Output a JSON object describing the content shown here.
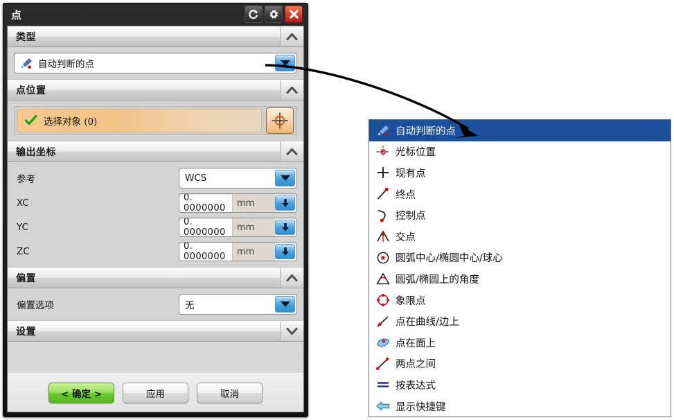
{
  "dialog": {
    "title": "点",
    "title_buttons": [
      {
        "name": "reset-button",
        "icon": "reset-icon"
      },
      {
        "name": "settings-button",
        "icon": "gear-icon"
      },
      {
        "name": "close-button",
        "icon": "close-icon"
      }
    ],
    "sections": [
      {
        "label": "类型",
        "state": "expanded",
        "chevron": "chevron-up-icon"
      },
      {
        "label": "点位置",
        "state": "expanded",
        "chevron": "chevron-up-icon"
      },
      {
        "label": "输出坐标",
        "state": "expanded",
        "chevron": "chevron-up-icon"
      },
      {
        "label": "偏置",
        "state": "expanded",
        "chevron": "chevron-up-icon"
      },
      {
        "label": "设置",
        "state": "collapsed",
        "chevron": "chevron-down-icon"
      }
    ],
    "type_combo": {
      "value": "自动判断的点",
      "icon": "inferred-point-icon"
    },
    "point_location": {
      "select_object_label": "选择对象 (0)",
      "check_icon": "green-check-icon",
      "pick_button_icon": "crosshair-point-icon"
    },
    "output_coordinates": {
      "reference_label": "参考",
      "reference_value": "WCS",
      "fields": [
        {
          "label": "XC",
          "value": "0. 0000000",
          "unit": "mm"
        },
        {
          "label": "YC",
          "value": "0. 0000000",
          "unit": "mm"
        },
        {
          "label": "ZC",
          "value": "0. 0000000",
          "unit": "mm"
        }
      ]
    },
    "offset": {
      "option_label": "偏置选项",
      "option_value": "无"
    },
    "buttons": {
      "ok": "< 确定 >",
      "apply": "应用",
      "cancel": "取消"
    }
  },
  "dropdown_list": {
    "items": [
      {
        "label": "自动判断的点",
        "icon": "inferred-point-icon",
        "selected": true
      },
      {
        "label": "光标位置",
        "icon": "cursor-location-icon",
        "selected": false
      },
      {
        "label": "现有点",
        "icon": "existing-point-icon",
        "selected": false
      },
      {
        "label": "终点",
        "icon": "end-point-icon",
        "selected": false
      },
      {
        "label": "控制点",
        "icon": "control-point-icon",
        "selected": false
      },
      {
        "label": "交点",
        "icon": "intersection-point-icon",
        "selected": false
      },
      {
        "label": "圆弧中心/椭圆中心/球心",
        "icon": "arc-center-icon",
        "selected": false
      },
      {
        "label": "圆弧/椭圆上的角度",
        "icon": "arc-angle-icon",
        "selected": false
      },
      {
        "label": "象限点",
        "icon": "quadrant-point-icon",
        "selected": false
      },
      {
        "label": "点在曲线/边上",
        "icon": "point-on-curve-icon",
        "selected": false
      },
      {
        "label": "点在面上",
        "icon": "point-on-face-icon",
        "selected": false
      },
      {
        "label": "两点之间",
        "icon": "between-two-points-icon",
        "selected": false
      },
      {
        "label": "按表达式",
        "icon": "by-expression-icon",
        "selected": false
      },
      {
        "label": "显示快捷键",
        "icon": "show-shortcuts-icon",
        "selected": false
      }
    ]
  },
  "colors": {
    "selection_blue": "#1c4f9c",
    "ok_green": "#66c92c",
    "select_orange": "#f3c387",
    "close_red": "#d9452a"
  }
}
